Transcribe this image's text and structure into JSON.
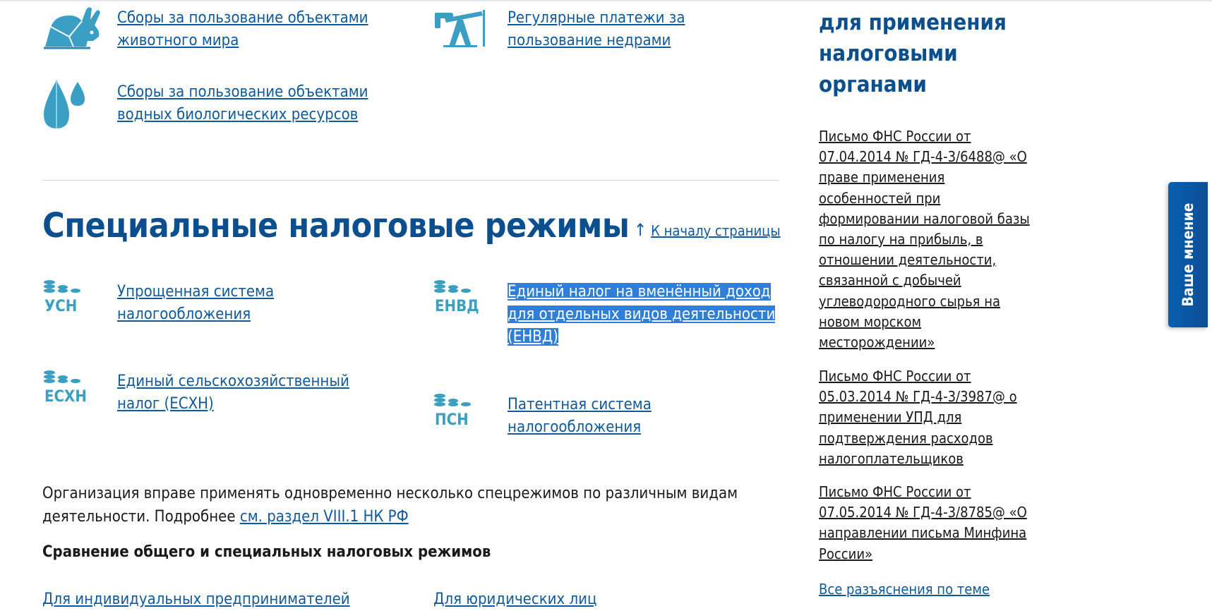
{
  "fees": [
    {
      "icon": "rabbit-icon",
      "line1": "Сборы за пользование объектами",
      "line2": "животного мира"
    },
    {
      "icon": "oil-derrick-icon",
      "line1": "Регулярные платежи за",
      "line2": "пользование недрами"
    },
    {
      "icon": "water-drops-icon",
      "line1": "Сборы за пользование объектами",
      "line2": "водных биологических ресурсов"
    }
  ],
  "section": {
    "title": "Специальные налоговые режимы",
    "to_top_arrow": "↑",
    "to_top_label": "К началу страницы"
  },
  "regimes": [
    {
      "abbr": "УСН",
      "lines": [
        "Упрощенная система",
        "налогообложения"
      ]
    },
    {
      "abbr": "ЕНВД",
      "lines": [
        "Единый налог на вменённый доход",
        "для отдельных видов деятельности",
        "(ЕНВД)"
      ],
      "selected": true
    },
    {
      "abbr": "ЕСХН",
      "lines": [
        "Единый сельскохозяйственный",
        "налог (ЕСХН)"
      ]
    },
    {
      "abbr": "ПСН",
      "lines": [
        "Патентная система",
        "налогообложения"
      ]
    }
  ],
  "paragraph": {
    "line1": "Организация вправе применять одновременно несколько спецрежимов по различным видам",
    "line2_prefix": "деятельности. Подробнее ",
    "link": "см. раздел VIII.1 НК РФ"
  },
  "compare_heading": "Сравнение общего и специальных налоговых режимов",
  "compare_tabs": [
    "Для индивидуальных предпринимателей",
    "Для юридических лиц"
  ],
  "sidebar": {
    "heading_lines": [
      "для применения",
      "налоговыми",
      "органами"
    ],
    "letters": [
      [
        "Письмо ФНС России от",
        "07.04.2014 № ГД-4-3/6488@ «О",
        "праве применения",
        "особенностей при",
        "формировании налоговой базы",
        "по налогу на прибыль, в",
        "отношении деятельности,",
        "связанной с добычей",
        "углеводородного сырья на",
        "новом морском",
        "месторождении»"
      ],
      [
        "Письмо ФНС России от",
        "05.03.2014 № ГД-4-3/3987@ о",
        "применении УПД для",
        "подтверждения расходов",
        "налогоплательщиков"
      ],
      [
        "Письмо ФНС России от",
        "07.05.2014 № ГД-4-3/8785@ «О",
        "направлении письма Минфина",
        "России»"
      ]
    ],
    "all_link": "Все разъяснения по теме"
  },
  "feedback_tab": "Ваше мнение",
  "colors": {
    "link": "#0f5a9c",
    "title": "#0c4f8f",
    "icon": "#3a9fc3",
    "selection": "#2f7fd9",
    "feedback": "#0b58a6"
  }
}
